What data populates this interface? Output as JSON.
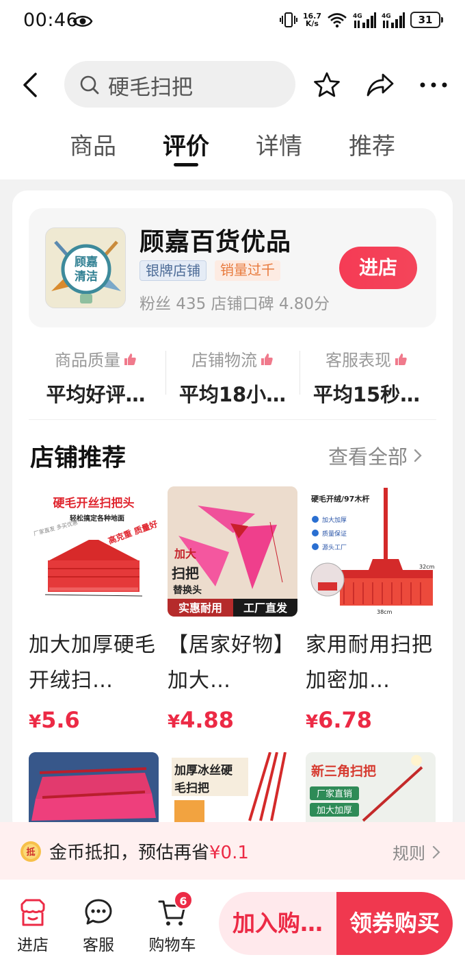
{
  "status_bar": {
    "time": "00:46",
    "net_speed_top": "16.7",
    "net_speed_bottom": "K/s",
    "sig1": "4G",
    "sig2": "4G",
    "battery": "31"
  },
  "header": {
    "search_text": "硬毛扫把"
  },
  "tabs": [
    {
      "label": "商品"
    },
    {
      "label": "评价"
    },
    {
      "label": "详情"
    },
    {
      "label": "推荐"
    }
  ],
  "shop": {
    "logo_text_1": "顾嘉",
    "logo_text_2": "清洁",
    "name": "顾嘉百货优品",
    "badge_silver": "银牌店铺",
    "badge_sales": "销量过千",
    "stats": "粉丝 435  店铺口碑 4.80分",
    "enter_label": "进店"
  },
  "ratings": [
    {
      "label": "商品质量",
      "value": "平均好评…"
    },
    {
      "label": "店铺物流",
      "value": "平均18小…"
    },
    {
      "label": "客服表现",
      "value": "平均15秒…"
    }
  ],
  "recommend": {
    "title": "店铺推荐",
    "view_all": "查看全部"
  },
  "products": [
    {
      "title": "加大加厚硬毛开绒扫…",
      "currency": "¥",
      "price": "5.6",
      "img_title": "硬毛开丝扫把头",
      "img_sub": "轻松搞定各种地面",
      "img_note": "厂家直发 多买优惠",
      "img_tag": "高克重 质量好"
    },
    {
      "title": "【居家好物】加大…",
      "currency": "¥",
      "price": "4.88",
      "img_t1": "加大",
      "img_t2": "扫把",
      "img_t3": "替换头",
      "img_b1": "实惠耐用",
      "img_b2": "工厂直发"
    },
    {
      "title": "家用耐用扫把加密加…",
      "currency": "¥",
      "price": "6.78",
      "img_title": "硬毛开绒/97木杆",
      "img_l1": "加大加厚",
      "img_l2": "质量保证",
      "img_l3": "源头工厂",
      "img_w": "38cm",
      "img_h": "32cm"
    },
    {
      "title": "",
      "currency": "",
      "price": ""
    },
    {
      "title": "",
      "currency": "",
      "price": "",
      "img_title": "加厚冰丝硬毛扫把"
    },
    {
      "title": "",
      "currency": "",
      "price": "",
      "img_title": "新三角扫把",
      "img_l1": "厂家直销",
      "img_l2": "加大加厚"
    }
  ],
  "coin_bar": {
    "icon_text": "抵",
    "text_main": "金币抵扣，预估再省",
    "text_highlight": "¥0.1",
    "rule": "规则"
  },
  "bottom_bar": {
    "store": "进店",
    "service": "客服",
    "cart": "购物车",
    "cart_count": "6",
    "add_cart": "加入购…",
    "buy": "领券购买"
  },
  "colors": {
    "accent": "#ec2a45",
    "enter_btn": "#f53b55",
    "silver_badge": "#4d6c97",
    "sales_badge": "#e87a3c"
  }
}
